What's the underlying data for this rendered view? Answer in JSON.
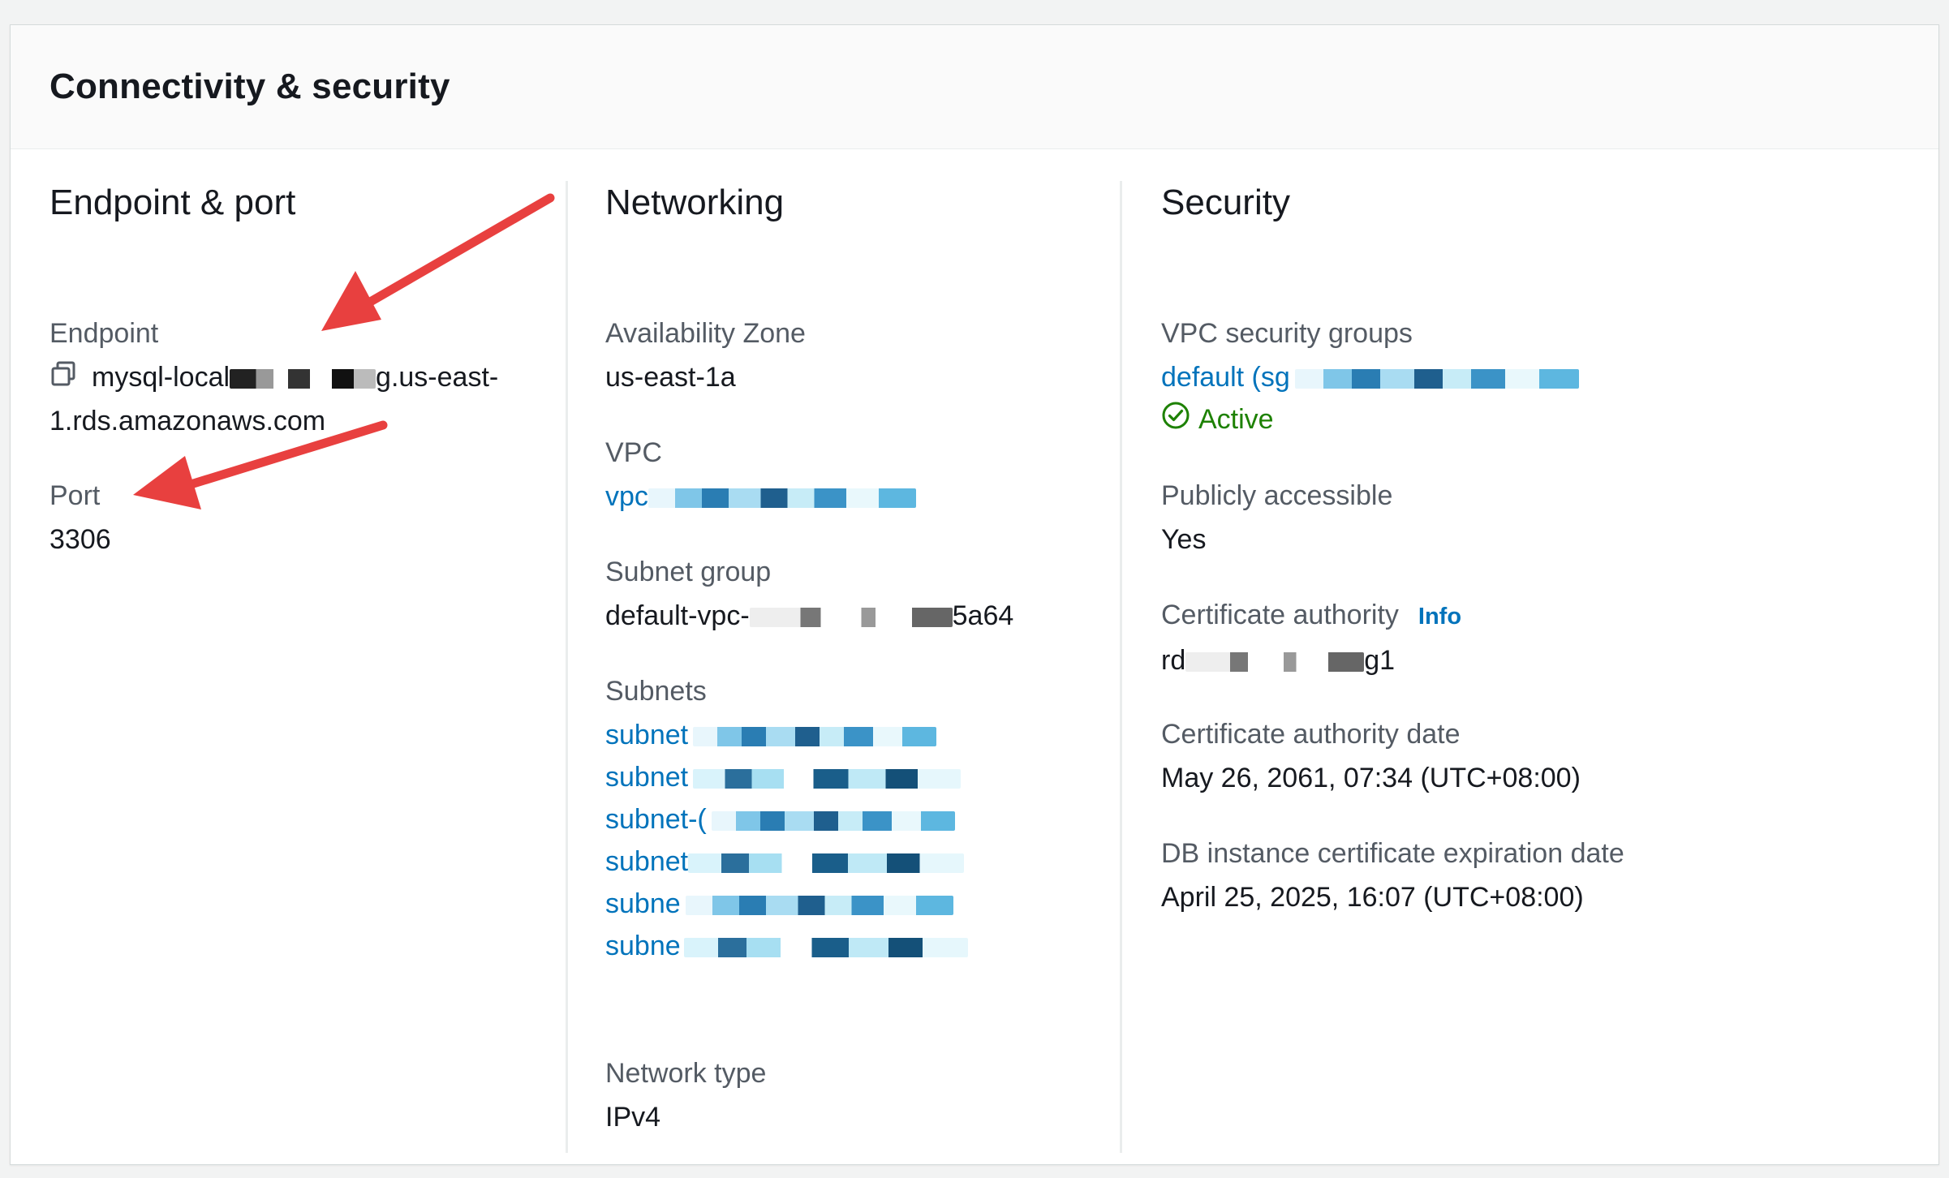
{
  "panel": {
    "title": "Connectivity & security"
  },
  "endpoint_port": {
    "heading": "Endpoint & port",
    "endpoint_label": "Endpoint",
    "endpoint_prefix": "mysql-local",
    "endpoint_suffix": "g.us-east-",
    "endpoint_line2": "1.rds.amazonaws.com",
    "port_label": "Port",
    "port_value": "3306",
    "copy_icon": "copy-icon"
  },
  "networking": {
    "heading": "Networking",
    "az_label": "Availability Zone",
    "az_value": "us-east-1a",
    "vpc_label": "VPC",
    "vpc_value": "vpc",
    "subnet_group_label": "Subnet group",
    "subnet_group_prefix": "default-vpc-",
    "subnet_group_suffix": "5a64",
    "subnets_label": "Subnets",
    "subnets": [
      "subnet",
      "subnet",
      "subnet-(",
      "subnet",
      "subne",
      "subne"
    ],
    "network_type_label": "Network type",
    "network_type_value": "IPv4"
  },
  "security": {
    "heading": "Security",
    "vpc_sg_label": "VPC security groups",
    "vpc_sg_value": "default (sg",
    "sg_status": "Active",
    "public_label": "Publicly accessible",
    "public_value": "Yes",
    "ca_label": "Certificate authority",
    "ca_info": "Info",
    "ca_prefix": "rd",
    "ca_suffix": "g1",
    "ca_date_label": "Certificate authority date",
    "ca_date_value": "May 26, 2061, 07:34 (UTC+08:00)",
    "db_cert_exp_label": "DB instance certificate expiration date",
    "db_cert_exp_value": "April 25, 2025, 16:07 (UTC+08:00)"
  },
  "colors": {
    "link": "#0073bb",
    "active": "#1d8102",
    "annotation_arrow": "#e8403f"
  }
}
